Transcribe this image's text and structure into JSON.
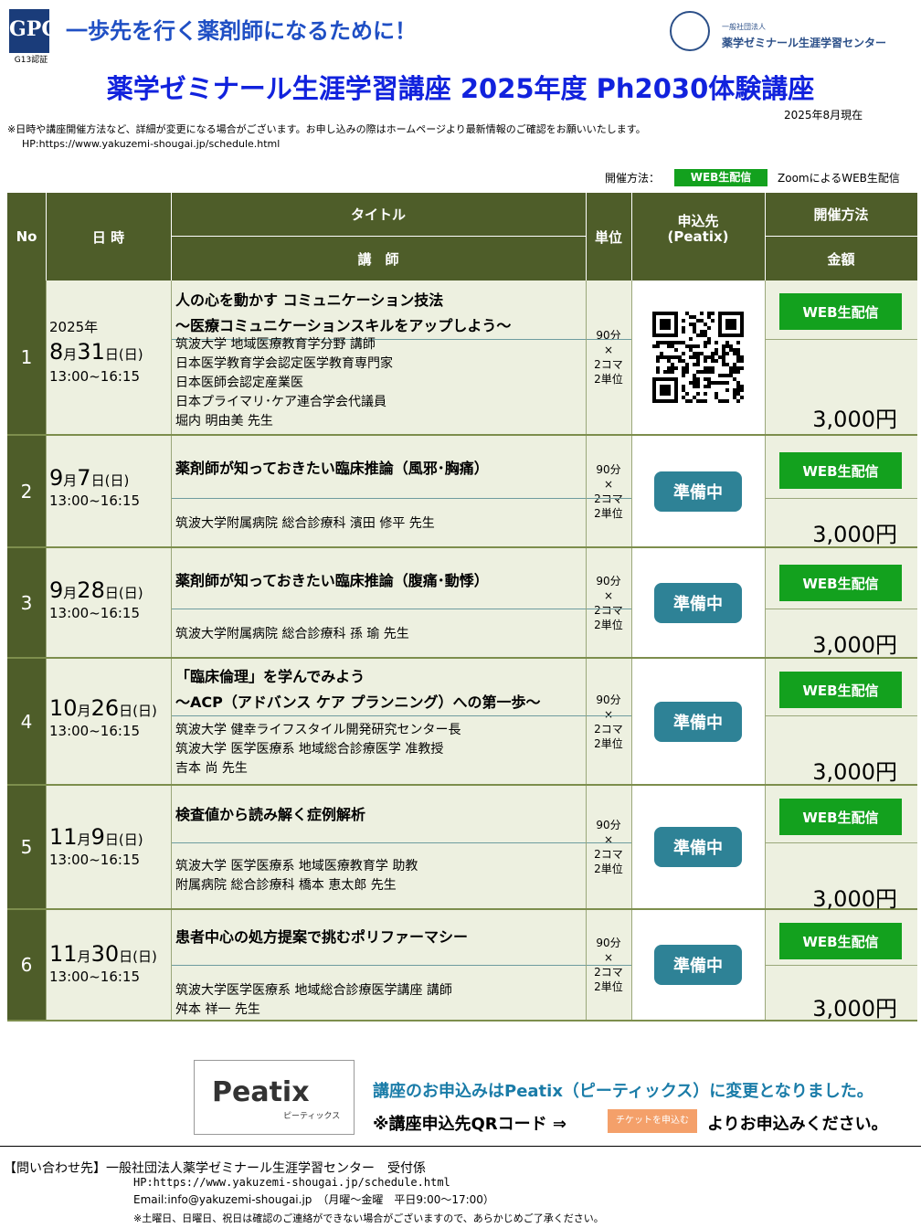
{
  "header": {
    "logo_text": "GPC",
    "logo_sub": "G13認証",
    "slogan": "一歩先を行く薬剤師になるために！",
    "org_small": "一般社団法人",
    "org_name": "薬学ゼミナール生涯学習センター",
    "title": "薬学ゼミナール生涯学習講座 2025年度 Ph2030体験講座",
    "date_note": "2025年8月現在",
    "notice": "※日時や講座開催方法など、詳細が変更になる場合がございます。お申し込みの際はホームページより最新情報のご確認をお願いいたします。",
    "hp": "HP:https://www.yakuzemi-shougai.jp/schedule.html"
  },
  "legend": {
    "label": "開催方法：",
    "badge": "WEB生配信",
    "desc": "ZoomによるWEB生配信"
  },
  "table_header": {
    "no": "No",
    "date": "日 時",
    "title": "タイトル",
    "lecturer": "講　師",
    "unit": "単位",
    "apply_line1": "申込先",
    "apply_line2": "(Peatix)",
    "method": "開催方法",
    "price": "金額"
  },
  "rows": [
    {
      "no": "1",
      "year": "2025年",
      "month": "8",
      "day": "31",
      "dow": "(日)",
      "time": "13:00~16:15",
      "title": "人の心を動かす コミュニケーション技法",
      "subtitle": "～医療コミュニケーションスキルをアップしよう～",
      "lecturer": [
        "筑波大学 地域医療教育学分野 講師",
        "日本医学教育学会認定医学教育専門家",
        "日本医師会認定産業医",
        "日本プライマリ･ケア連合学会代議員",
        "堀内 明由美 先生"
      ],
      "unit": [
        "90分",
        "×",
        "2コマ",
        "2単位"
      ],
      "apply": "qr",
      "method": "WEB生配信",
      "price": "3,000円"
    },
    {
      "no": "2",
      "year": "",
      "month": "9",
      "day": "7",
      "dow": "(日)",
      "time": "13:00~16:15",
      "title": "薬剤師が知っておきたい臨床推論（風邪･胸痛）",
      "subtitle": "",
      "lecturer": [
        "筑波大学附属病院 総合診療科 濱田 修平 先生"
      ],
      "unit": [
        "90分",
        "×",
        "2コマ",
        "2単位"
      ],
      "apply": "準備中",
      "method": "WEB生配信",
      "price": "3,000円"
    },
    {
      "no": "3",
      "year": "",
      "month": "9",
      "day": "28",
      "dow": "(日)",
      "time": "13:00~16:15",
      "title": "薬剤師が知っておきたい臨床推論（腹痛･動悸）",
      "subtitle": "",
      "lecturer": [
        "筑波大学附属病院 総合診療科 孫 瑜 先生"
      ],
      "unit": [
        "90分",
        "×",
        "2コマ",
        "2単位"
      ],
      "apply": "準備中",
      "method": "WEB生配信",
      "price": "3,000円"
    },
    {
      "no": "4",
      "year": "",
      "month": "10",
      "day": "26",
      "dow": "(日)",
      "time": "13:00~16:15",
      "title": "「臨床倫理」を学んでみよう",
      "subtitle": "～ACP（アドバンス ケア プランニング）への第一歩～",
      "lecturer": [
        "筑波大学 健幸ライフスタイル開発研究センター長",
        "筑波大学 医学医療系 地域総合診療医学 准教授",
        "吉本 尚 先生"
      ],
      "unit": [
        "90分",
        "×",
        "2コマ",
        "2単位"
      ],
      "apply": "準備中",
      "method": "WEB生配信",
      "price": "3,000円"
    },
    {
      "no": "5",
      "year": "",
      "month": "11",
      "day": "9",
      "dow": "(日)",
      "time": "13:00~16:15",
      "title": "検査値から読み解く症例解析",
      "subtitle": "",
      "lecturer": [
        "筑波大学 医学医療系 地域医療教育学 助教",
        "附属病院 総合診療科 橋本 恵太郎 先生"
      ],
      "unit": [
        "90分",
        "×",
        "2コマ",
        "2単位"
      ],
      "apply": "準備中",
      "method": "WEB生配信",
      "price": "3,000円"
    },
    {
      "no": "6",
      "year": "",
      "month": "11",
      "day": "30",
      "dow": "(日)",
      "time": "13:00~16:15",
      "title": "患者中心の処方提案で挑むポリファーマシー",
      "subtitle": "",
      "lecturer": [
        "筑波大学医学医療系 地域総合診療医学講座 講師",
        "舛本 祥一 先生"
      ],
      "unit": [
        "90分",
        "×",
        "2コマ",
        "2単位"
      ],
      "apply": "準備中",
      "method": "WEB生配信",
      "price": "3,000円"
    }
  ],
  "month_suffix": "月",
  "day_suffix": "日",
  "peatix": {
    "logo": "Peatix",
    "logo_sub": "ピーティックス",
    "msg1": "講座のお申込みはPeatix（ピーティックス）に変更となりました。",
    "msg2": "※講座申込先QRコード ⇒",
    "ticket": "チケットを申込む",
    "msg2_tail": "よりお申込みください。"
  },
  "contact": {
    "title": "【問い合わせ先】一般社団法人薬学ゼミナール生涯学習センター　受付係",
    "hp": "HP:https://www.yakuzemi-shougai.jp/schedule.html",
    "mail": "Email:info@yakuzemi-shougai.jp　（月曜～金曜　平日9:00～17:00）",
    "note": "※土曜日、日曜日、祝日は確認のご連絡ができない場合がございますので、あらかじめご了承ください。"
  }
}
